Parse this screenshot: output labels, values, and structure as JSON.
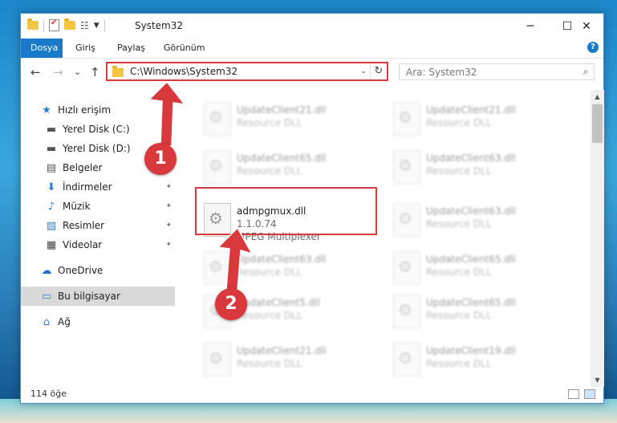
{
  "window": {
    "title": "System32",
    "minimize": "─",
    "maximize": "☐",
    "close": "✕"
  },
  "ribbon": {
    "tabs": [
      "Dosya",
      "Giriş",
      "Paylaş",
      "Görünüm"
    ],
    "help": "?"
  },
  "nav": {
    "back": "←",
    "forward": "→",
    "recent": "⌄",
    "up": "↑",
    "address": "C:\\Windows\\System32",
    "address_dropdown": "⌄",
    "refresh": "↻",
    "search_placeholder": "Ara: System32",
    "search_icon": "⌕"
  },
  "sidebar": {
    "items": [
      {
        "label": "Hızlı erişim",
        "icon": "star-icon",
        "glyph": "★",
        "color": "#2b79d0",
        "pinned": false
      },
      {
        "label": "Yerel Disk (C:)",
        "icon": "drive-icon",
        "glyph": "▬",
        "color": "#555555",
        "pinned": false
      },
      {
        "label": "Yerel Disk (D:)",
        "icon": "drive-icon",
        "glyph": "▬",
        "color": "#555555",
        "pinned": false
      },
      {
        "label": "Belgeler",
        "icon": "documents-icon",
        "glyph": "▤",
        "color": "#555555",
        "pinned": true
      },
      {
        "label": "İndirmeler",
        "icon": "downloads-icon",
        "glyph": "⬇",
        "color": "#2b79d0",
        "pinned": true
      },
      {
        "label": "Müzik",
        "icon": "music-icon",
        "glyph": "♪",
        "color": "#2b79d0",
        "pinned": true
      },
      {
        "label": "Resimler",
        "icon": "pictures-icon",
        "glyph": "▧",
        "color": "#3a7bbf",
        "pinned": true
      },
      {
        "label": "Videolar",
        "icon": "videos-icon",
        "glyph": "▦",
        "color": "#444444",
        "pinned": true
      },
      {
        "label": "OneDrive",
        "icon": "onedrive-icon",
        "glyph": "☁",
        "color": "#1a6ec4",
        "pinned": false
      },
      {
        "label": "Bu bilgisayar",
        "icon": "computer-icon",
        "glyph": "▭",
        "color": "#3a7bbf",
        "pinned": false,
        "selected": true
      },
      {
        "label": "Ağ",
        "icon": "network-icon",
        "glyph": "⌂",
        "color": "#3a7bbf",
        "pinned": false
      }
    ],
    "pin_glyph": "📌"
  },
  "files": [
    {
      "name": "UpdateClient21.dll",
      "desc": "Resource DLL",
      "blurred": true
    },
    {
      "name": "UpdateClient21.dll",
      "desc": "Resource DLL",
      "blurred": true
    },
    {
      "name": "UpdateClient65.dll",
      "desc": "Resource DLL",
      "blurred": true
    },
    {
      "name": "UpdateClient63.dll",
      "desc": "Resource DLL",
      "blurred": true
    },
    {
      "name": "admpgmux.dll",
      "version": "1.1.0.74",
      "desc": "MPEG Multiplexer",
      "blurred": false
    },
    {
      "name": "UpdateClient63.dll",
      "desc": "Resource DLL",
      "blurred": true
    },
    {
      "name": "UpdateClient63.dll",
      "desc": "Resource DLL",
      "blurred": true
    },
    {
      "name": "UpdateClient65.dll",
      "desc": "Resource DLL",
      "blurred": true
    },
    {
      "name": "UpdateClient5.dll",
      "desc": "Resource DLL",
      "blurred": true
    },
    {
      "name": "UpdateClient65.dll",
      "desc": "Resource DLL",
      "blurred": true
    },
    {
      "name": "UpdateClient21.dll",
      "desc": "Resource DLL",
      "blurred": true
    },
    {
      "name": "UpdateClient19.dll",
      "desc": "Resource DLL",
      "blurred": true
    }
  ],
  "status": {
    "count": "114 öğe"
  },
  "annotations": {
    "badge1": "1",
    "badge2": "2",
    "color": "#d9393c"
  }
}
